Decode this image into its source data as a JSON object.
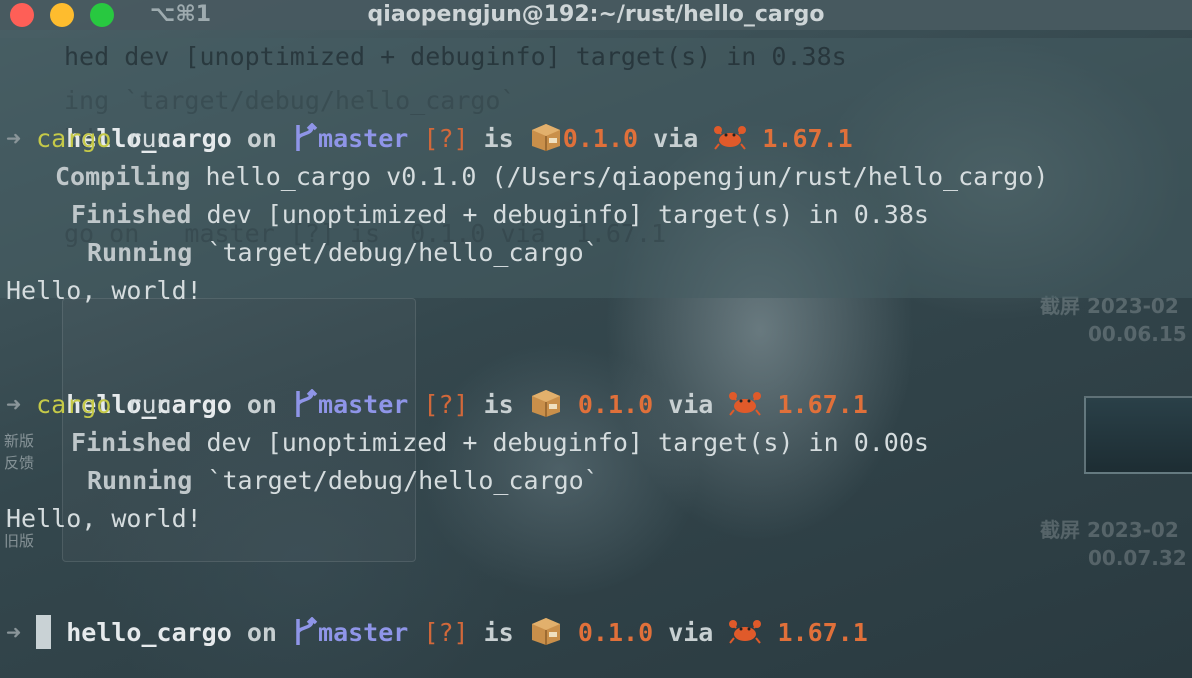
{
  "window": {
    "title": "qiaopengjun@192:~/rust/hello_cargo",
    "tab_shortcut": "⌥⌘1"
  },
  "background_terminal": {
    "line1": "hed dev [unoptimized + debuginfo] target(s) in 0.38s",
    "line2": "ing `target/debug/hello_cargo`",
    "line3": "ld!",
    "line4": "go on   master [?] is  0.1.0 via  1.67.1"
  },
  "desktop": {
    "screenshot1_label": "截屏 2023-02",
    "screenshot1_time": "00.06.15",
    "screenshot2_label": "截屏 2023-02",
    "screenshot2_time": "00.07.32",
    "side_label_new": "新版",
    "side_label_feedback": "反馈",
    "side_label_old": "旧版"
  },
  "prompt": {
    "dir": "hello_cargo",
    "on": "on",
    "branch": "master",
    "status": "[?]",
    "is": "is",
    "version": "0.1.0",
    "via": "via",
    "rust_version": "1.67.1",
    "arrow": "➜"
  },
  "session": [
    {
      "command": "cargo",
      "command_arg": "run",
      "output": [
        {
          "label": "Compiling",
          "text": "hello_cargo v0.1.0 (/Users/qiaopengjun/rust/hello_cargo)"
        },
        {
          "label": "Finished",
          "text": "dev [unoptimized + debuginfo] target(s) in 0.38s"
        },
        {
          "label": "Running",
          "text": "`target/debug/hello_cargo`"
        }
      ],
      "program_output": "Hello, world!"
    },
    {
      "command": "cargo",
      "command_arg": "run",
      "output": [
        {
          "label": "Finished",
          "text": "dev [unoptimized + debuginfo] target(s) in 0.00s"
        },
        {
          "label": "Running",
          "text": "`target/debug/hello_cargo`"
        }
      ],
      "program_output": "Hello, world!"
    }
  ],
  "colors": {
    "branch": "#8f95e8",
    "version": "#e0703a",
    "command": "#c5c948",
    "status": "#d2683a"
  },
  "icons": {
    "git_branch": "git-branch-icon",
    "package": "package-icon",
    "rust": "crab-icon"
  }
}
